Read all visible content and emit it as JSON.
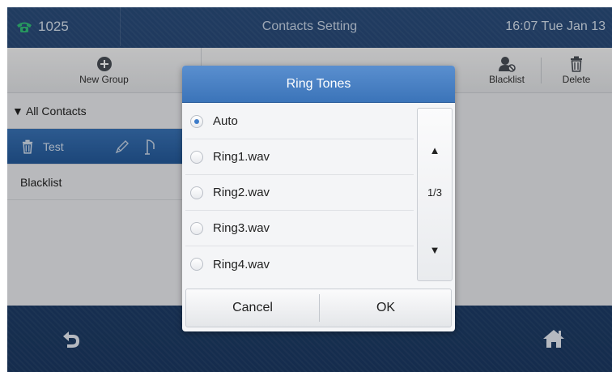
{
  "status": {
    "extension": "1025",
    "title": "Contacts Setting",
    "datetime": "16:07 Tue Jan 13"
  },
  "toolbar": {
    "new_group": "New Group",
    "blacklist": "Blacklist",
    "delete": "Delete"
  },
  "sidebar": {
    "items": [
      {
        "label": "▼ All Contacts"
      },
      {
        "label": "Test"
      },
      {
        "label": "Blacklist"
      }
    ]
  },
  "dialog": {
    "title": "Ring Tones",
    "options": [
      {
        "label": "Auto",
        "selected": true
      },
      {
        "label": "Ring1.wav",
        "selected": false
      },
      {
        "label": "Ring2.wav",
        "selected": false
      },
      {
        "label": "Ring3.wav",
        "selected": false
      },
      {
        "label": "Ring4.wav",
        "selected": false
      }
    ],
    "page_indicator": "1/3",
    "up_arrow": "▲",
    "down_arrow": "▼",
    "cancel_label": "Cancel",
    "ok_label": "OK"
  },
  "colors": {
    "accent": "#3b74b9",
    "selected_row": "#245a9b",
    "radio_selected": "#3d7cc9"
  }
}
